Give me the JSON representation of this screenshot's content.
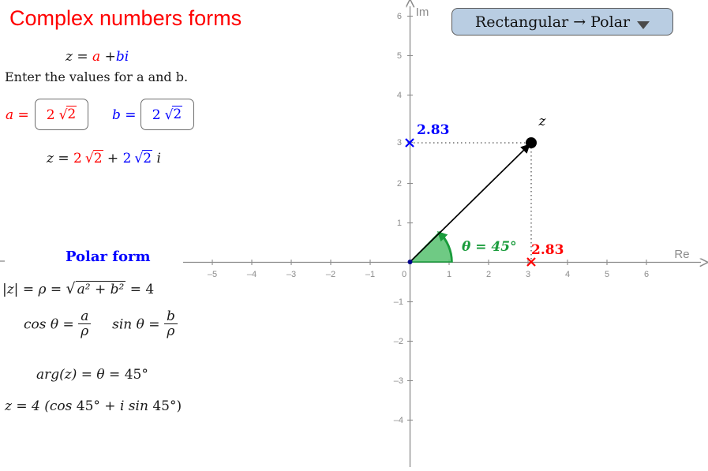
{
  "title": "Complex numbers forms",
  "dropdown": {
    "label": "Rectangular → Polar",
    "caret": "chevron-down-icon"
  },
  "rectangular": {
    "definition_lhs": "z =",
    "definition_a": "a",
    "definition_plus": "+",
    "definition_b": "b",
    "definition_i": "i",
    "instruction": "Enter the values for a and b.",
    "label_a": "a =",
    "label_b": "b =",
    "value_a": "2 √2",
    "value_b": "2 √2",
    "value_a_coef": "2",
    "value_a_radicand": "2",
    "value_b_coef": "2",
    "value_b_radicand": "2",
    "result_lhs": "z =",
    "result_a_coef": "2",
    "result_a_radicand": "2",
    "result_plus": "+",
    "result_b_coef": "2",
    "result_b_radicand": "2",
    "result_i": "i"
  },
  "polar": {
    "heading": "Polar form",
    "modulus_lhs": "|z| = ρ =",
    "modulus_radicand": "a² + b²",
    "modulus_eq": "=",
    "modulus_value": "4",
    "cos_label": "cos θ =",
    "cos_num": "a",
    "cos_den": "ρ",
    "sin_label": "sin θ =",
    "sin_num": "b",
    "sin_den": "ρ",
    "arg_label": "arg(z) = θ =",
    "arg_value": "45°",
    "trig_lhs": "z = 4 (cos",
    "trig_angle1": "45°",
    "trig_mid": "+ i sin",
    "trig_angle2": "45°",
    "trig_close": ")"
  },
  "graph": {
    "x_axis_label": "Re",
    "y_axis_label": "Im",
    "x_ticks": [
      "–5",
      "–4",
      "–3",
      "–2",
      "–1",
      "0",
      "1",
      "2",
      "3",
      "4",
      "5",
      "6"
    ],
    "y_ticks": [
      "6",
      "5",
      "4",
      "3",
      "2",
      "1",
      "–1",
      "–2",
      "–3",
      "–4"
    ],
    "point_label": "z",
    "real_projection_value": "2.83",
    "imag_projection_value": "2.83",
    "angle_label": "θ = 45°",
    "marker_real": "x-marker-red",
    "marker_imag": "x-marker-blue",
    "point_marker": "filled-dot"
  },
  "chart_data": {
    "type": "scatter",
    "title": "Complex numbers forms",
    "xlabel": "Re",
    "ylabel": "Im",
    "xlim": [
      -5.8,
      6.6
    ],
    "ylim": [
      -4.9,
      6.3
    ],
    "xticks": [
      -5,
      -4,
      -3,
      -2,
      -1,
      0,
      1,
      2,
      3,
      4,
      5,
      6
    ],
    "yticks": [
      6,
      5,
      4,
      3,
      2,
      1,
      -1,
      -2,
      -3,
      -4
    ],
    "grid": false,
    "legend": "none",
    "points": [
      {
        "name": "z",
        "x": 2.83,
        "y": 2.83,
        "color": "#000000",
        "label": "z"
      },
      {
        "name": "real-projection",
        "x": 2.83,
        "y": 0,
        "color": "#ff0000",
        "label": "2.83"
      },
      {
        "name": "imag-projection",
        "x": 0,
        "y": 2.83,
        "color": "#0000ff",
        "label": "2.83"
      }
    ],
    "vectors": [
      {
        "name": "z-vector",
        "from": [
          0,
          0
        ],
        "to": [
          2.83,
          2.83
        ],
        "color": "#000000"
      }
    ],
    "annotations": [
      {
        "name": "angle-arc",
        "value": 45,
        "unit": "degrees",
        "label": "θ = 45°",
        "color": "#22aa44"
      }
    ],
    "modulus": 4,
    "argument_degrees": 45
  },
  "colors": {
    "title": "#ff0000",
    "a_color": "#ff0000",
    "b_color": "#0000ff",
    "polar_heading": "#0000ff",
    "angle": "#1a9c3c",
    "axis": "#8c8c8c",
    "dropdown_bg": "#b9cde2"
  }
}
